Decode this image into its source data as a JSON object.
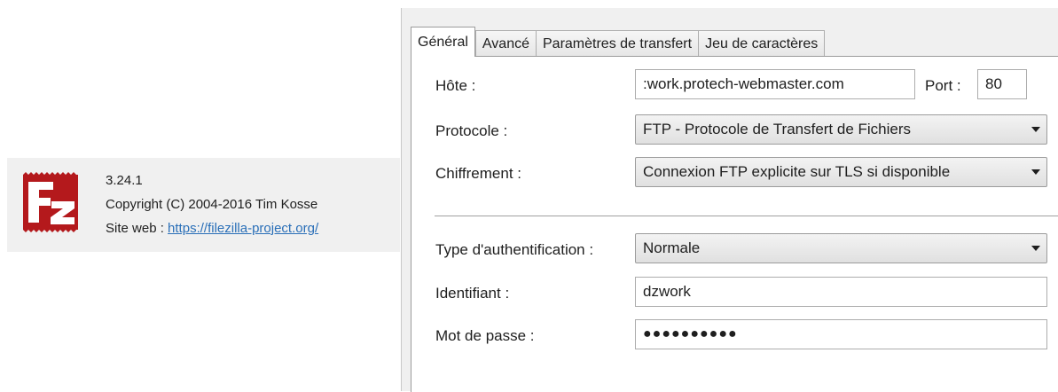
{
  "about": {
    "version": "3.24.1",
    "copyright": "Copyright (C) 2004-2016  Tim Kosse",
    "website_label": "Site web :",
    "website_url": "https://filezilla-project.org/",
    "logo_icon": "filezilla-logo-icon",
    "logo_color": "#b4191c"
  },
  "dialog": {
    "tabs": [
      {
        "label": "Général",
        "active": true
      },
      {
        "label": "Avancé",
        "active": false
      },
      {
        "label": "Paramètres de transfert",
        "active": false
      },
      {
        "label": "Jeu de caractères",
        "active": false
      }
    ],
    "host": {
      "label": "Hôte :",
      "value": ":work.protech-webmaster.com"
    },
    "port": {
      "label": "Port :",
      "value": "80"
    },
    "protocol": {
      "label": "Protocole :",
      "value": "FTP - Protocole de Transfert de Fichiers"
    },
    "encryption": {
      "label": "Chiffrement :",
      "value": "Connexion FTP explicite sur TLS si disponible"
    },
    "auth_type": {
      "label": "Type d'authentification :",
      "value": "Normale"
    },
    "username": {
      "label": "Identifiant :",
      "value": "dzwork"
    },
    "password": {
      "label": "Mot de passe :",
      "value": "●●●●●●●●●●"
    }
  }
}
